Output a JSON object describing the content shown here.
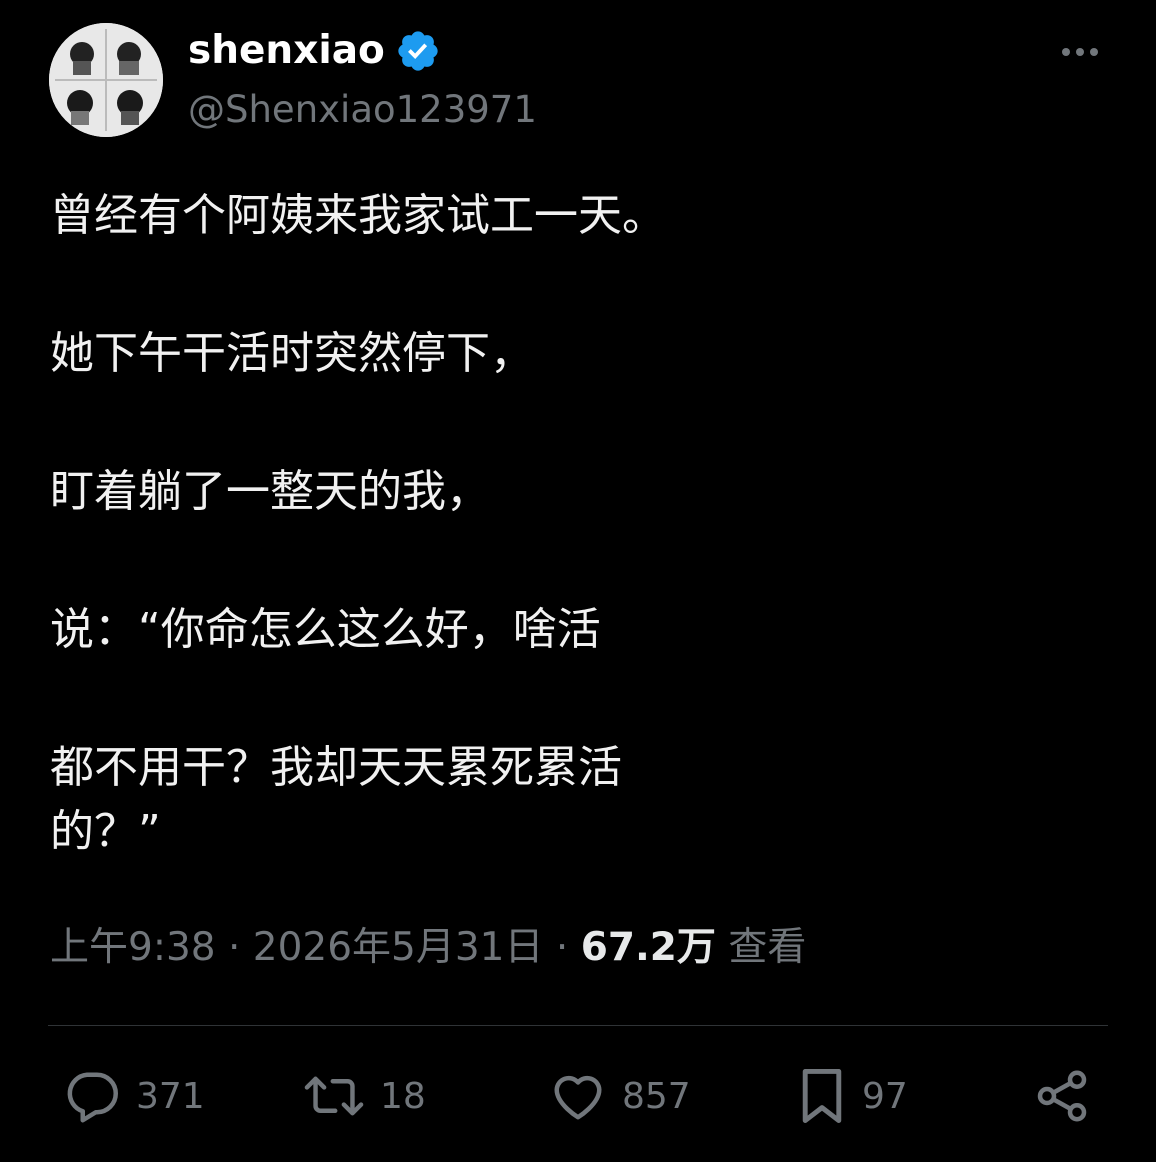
{
  "author": {
    "display_name": "shenxiao",
    "handle": "@Shenxiao123971",
    "verified": true,
    "avatar_icon": "avatar-image"
  },
  "header": {
    "more_icon": "more-icon"
  },
  "tweet": {
    "paragraphs": [
      "曾经有个阿姨来我家试工一天。",
      "她下午干活时突然停下，",
      "盯着躺了一整天的我，",
      "说：“你命怎么这么好，啥活",
      "都不用干？我却天天累死累活\n的？”"
    ]
  },
  "meta": {
    "time": "上午9:38",
    "separator": " · ",
    "date": "2026年5月31日",
    "views_count": "67.2万",
    "views_label": "查看"
  },
  "actions": {
    "reply_count": "371",
    "retweet_count": "18",
    "like_count": "857",
    "bookmark_count": "97"
  },
  "colors": {
    "background": "#000000",
    "verified_blue": "#1d9bf0",
    "muted": "#71767b",
    "text": "#e7e9ea",
    "divider": "#2f3336"
  }
}
